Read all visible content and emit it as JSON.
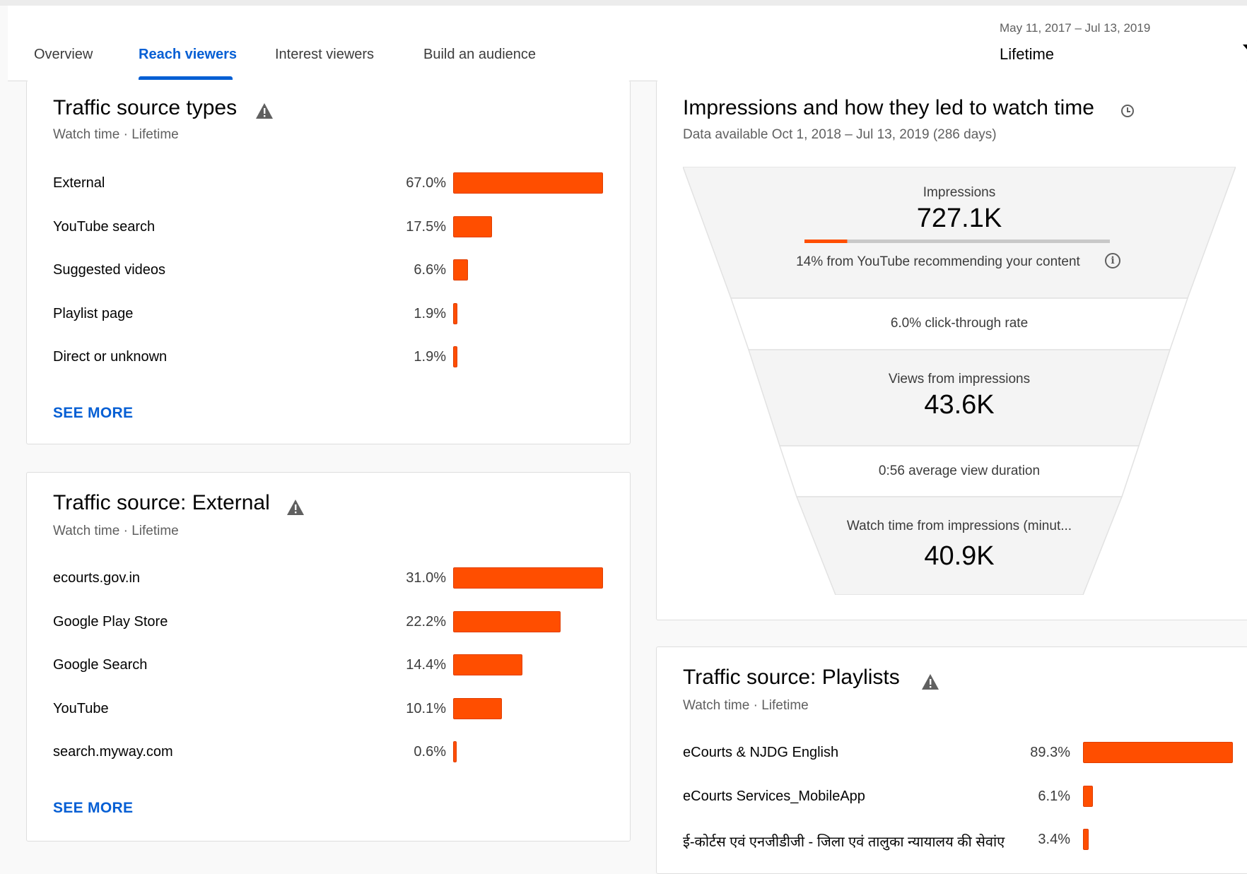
{
  "tabs": [
    {
      "label": "Overview",
      "active": false
    },
    {
      "label": "Reach viewers",
      "active": true
    },
    {
      "label": "Interest viewers",
      "active": false
    },
    {
      "label": "Build an audience",
      "active": false
    }
  ],
  "date_range": {
    "range": "May 11, 2017 – Jul 13, 2019",
    "period": "Lifetime"
  },
  "colors": {
    "accent": "#065fd4",
    "bar": "#ff4e00",
    "muted_text": "#606060"
  },
  "traffic_source_types": {
    "title": "Traffic source types",
    "subtitle": "Watch time · Lifetime",
    "icon": "warning-icon",
    "rows": [
      {
        "label": "External",
        "pct": "67.0%",
        "value": 67.0
      },
      {
        "label": "YouTube search",
        "pct": "17.5%",
        "value": 17.5
      },
      {
        "label": "Suggested videos",
        "pct": "6.6%",
        "value": 6.6
      },
      {
        "label": "Playlist page",
        "pct": "1.9%",
        "value": 1.9
      },
      {
        "label": "Direct or unknown",
        "pct": "1.9%",
        "value": 1.9
      }
    ],
    "see_more": "SEE MORE"
  },
  "traffic_source_external": {
    "title": "Traffic source: External",
    "subtitle": "Watch time · Lifetime",
    "icon": "warning-icon",
    "rows": [
      {
        "label": "ecourts.gov.in",
        "pct": "31.0%",
        "value": 31.0
      },
      {
        "label": "Google Play Store",
        "pct": "22.2%",
        "value": 22.2
      },
      {
        "label": "Google Search",
        "pct": "14.4%",
        "value": 14.4
      },
      {
        "label": "YouTube",
        "pct": "10.1%",
        "value": 10.1
      },
      {
        "label": "search.myway.com",
        "pct": "0.6%",
        "value": 0.6
      }
    ],
    "see_more": "SEE MORE"
  },
  "impressions_funnel": {
    "title": "Impressions and how they led to watch time",
    "subtitle": "Data available Oct 1, 2018 – Jul 13, 2019 (286 days)",
    "icon": "clock-icon",
    "impressions_label": "Impressions",
    "impressions_value": "727.1K",
    "recommend_fraction": 0.14,
    "recommend_text": "14% from YouTube recommending your content",
    "ctr_text": "6.0% click-through rate",
    "views_label": "Views from impressions",
    "views_value": "43.6K",
    "avg_duration_text": "0:56 average view duration",
    "watch_time_label": "Watch time from impressions (minut...",
    "watch_time_value": "40.9K"
  },
  "traffic_source_playlists": {
    "title": "Traffic source: Playlists",
    "subtitle": "Watch time · Lifetime",
    "icon": "warning-icon",
    "rows": [
      {
        "label": "eCourts & NJDG English",
        "pct": "89.3%",
        "value": 89.3
      },
      {
        "label": "eCourts Services_MobileApp",
        "pct": "6.1%",
        "value": 6.1
      },
      {
        "label": "ई-कोर्टस एवं एनजीडीजी - जिला एवं तालुका न्यायालय की सेवांए",
        "pct": "3.4%",
        "value": 3.4
      }
    ]
  }
}
